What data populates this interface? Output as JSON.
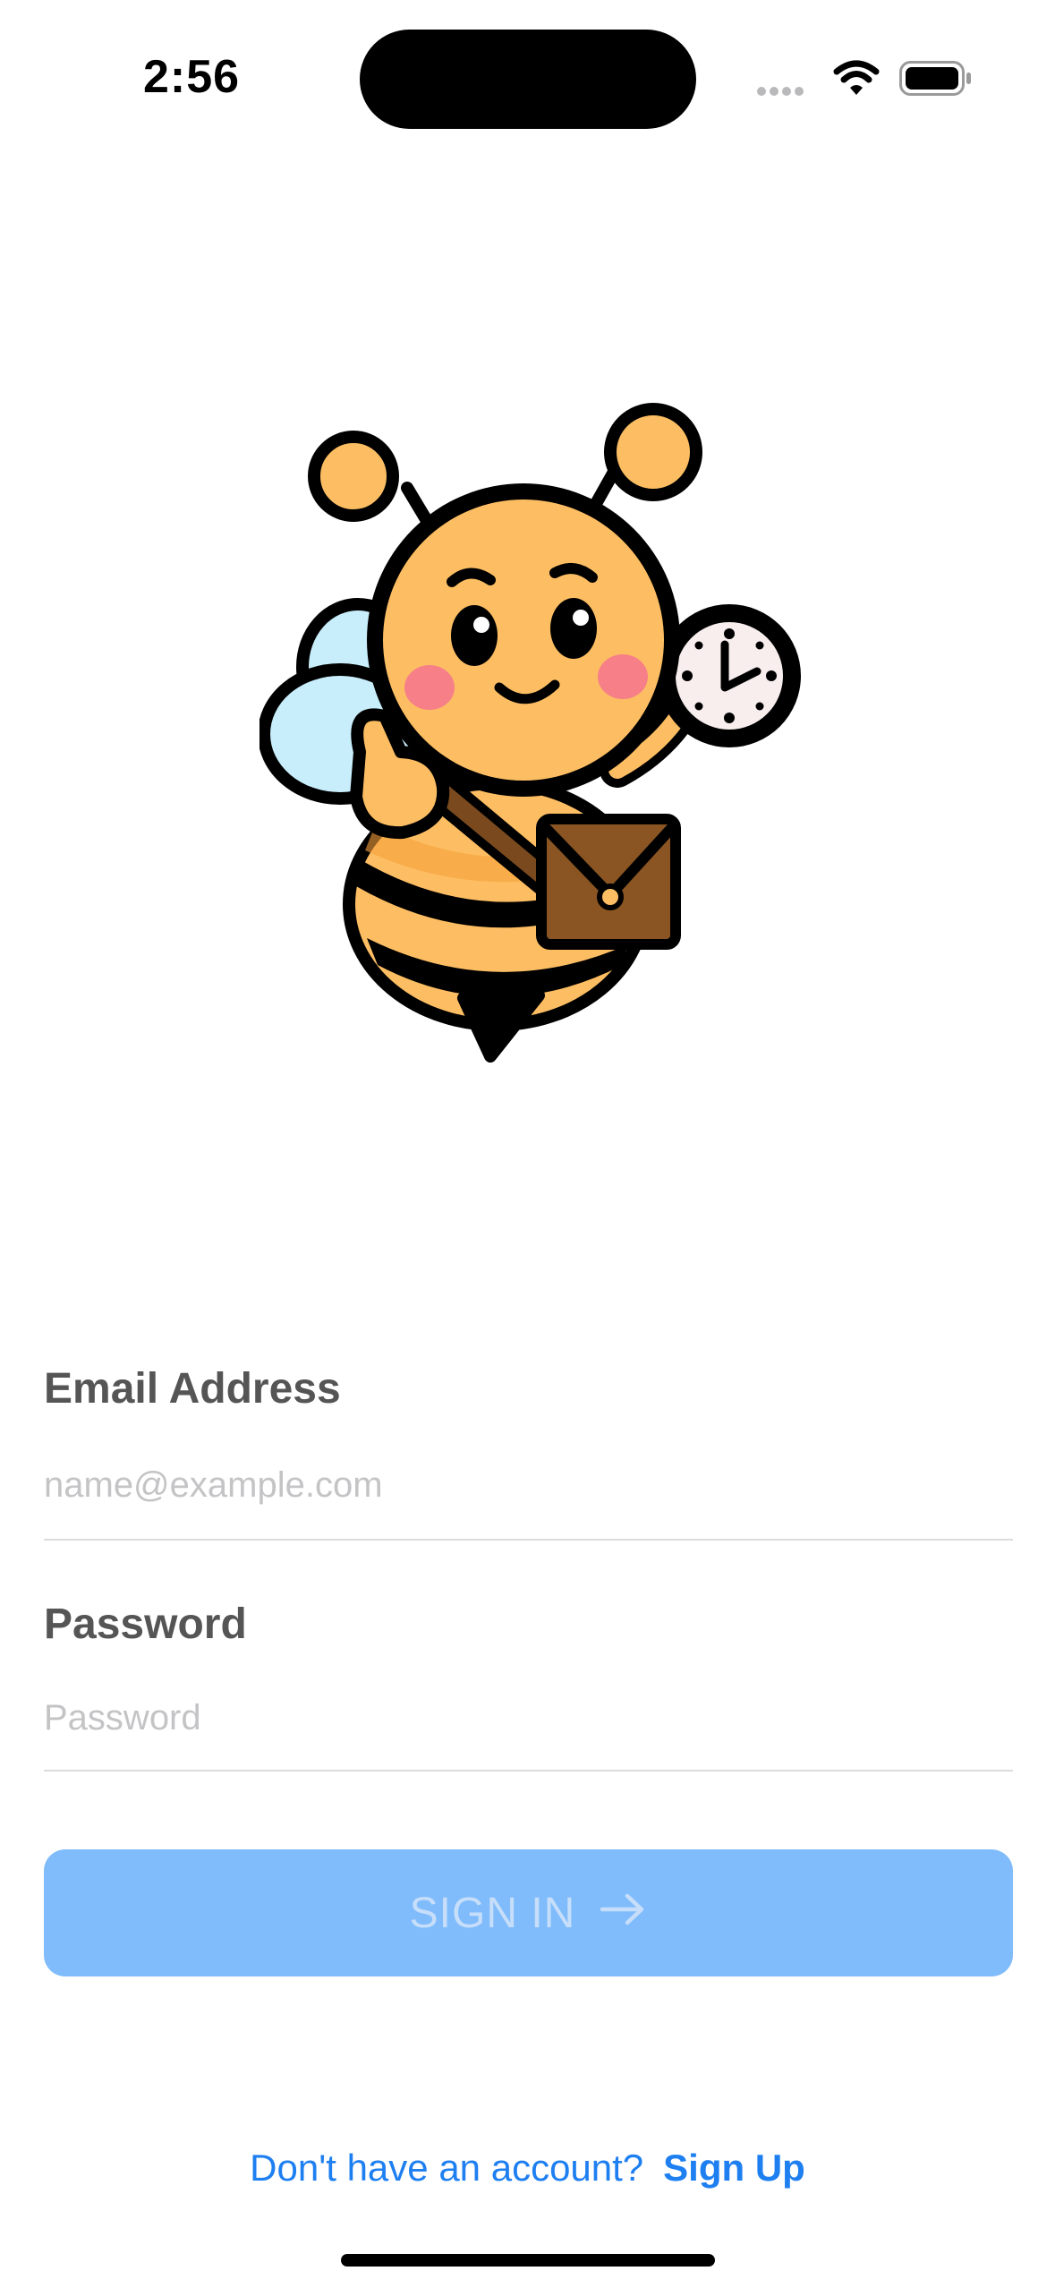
{
  "status_bar": {
    "time": "2:56",
    "icons": [
      "signal-dots-icon",
      "wifi-icon",
      "battery-icon"
    ]
  },
  "mascot": {
    "icon": "bee-mascot-with-clock-and-bag"
  },
  "form": {
    "email": {
      "label": "Email Address",
      "placeholder": "name@example.com",
      "value": ""
    },
    "password": {
      "label": "Password",
      "placeholder": "Password",
      "value": ""
    }
  },
  "sign_in_button": {
    "label": "SIGN IN",
    "icon": "arrow-right-icon",
    "color": "#80bcfb",
    "text_color": "#c6def9",
    "enabled": false
  },
  "footer": {
    "question": "Don't have an account?",
    "signup_label": "Sign Up"
  },
  "colors": {
    "accent": "#1e7ff1",
    "label": "#555555",
    "placeholder": "#c4c4c6"
  }
}
